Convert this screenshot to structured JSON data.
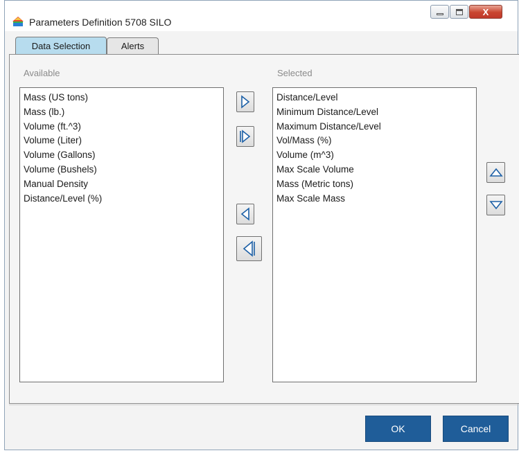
{
  "window": {
    "title": "Parameters Definition 5708 SILO",
    "close_label": "X"
  },
  "tabs": [
    {
      "label": "Data Selection",
      "active": true
    },
    {
      "label": "Alerts",
      "active": false
    }
  ],
  "available": {
    "label": "Available",
    "items": [
      "Mass (US tons)",
      "Mass (lb.)",
      "Volume (ft.^3)",
      "Volume (Liter)",
      "Volume (Gallons)",
      "Volume (Bushels)",
      "Manual Density",
      "Distance/Level (%)"
    ]
  },
  "selected": {
    "label": "Selected",
    "items": [
      "Distance/Level",
      "Minimum Distance/Level",
      "Maximum Distance/Level",
      "Vol/Mass (%)",
      "Volume (m^3)",
      "Max Scale Volume",
      "Mass (Metric tons)",
      "Max Scale Mass"
    ]
  },
  "buttons": {
    "ok": "OK",
    "cancel": "Cancel"
  },
  "colors": {
    "active_tab": "#b7dcee",
    "dialog_button": "#1f5d99",
    "close_button": "#c9452f"
  },
  "icons": {
    "app": "silo-app-icon",
    "move_right": "triangle-right-icon",
    "move_all_right": "double-triangle-right-icon",
    "move_left": "triangle-left-icon",
    "move_all_left": "double-triangle-left-icon",
    "move_up": "triangle-up-icon",
    "move_down": "triangle-down-icon"
  }
}
